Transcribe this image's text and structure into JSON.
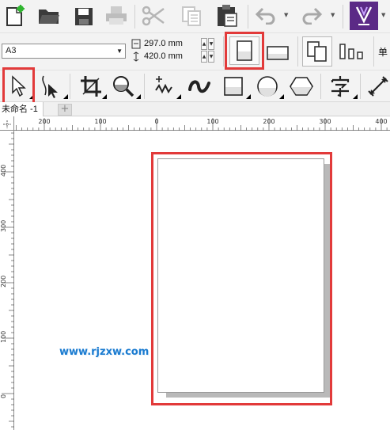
{
  "toolbar_standard": {
    "buttons": [
      {
        "name": "new-document-icon"
      },
      {
        "name": "open-folder-icon"
      },
      {
        "name": "save-icon"
      },
      {
        "name": "print-icon"
      },
      {
        "name": "cut-icon"
      },
      {
        "name": "copy-icon"
      },
      {
        "name": "paste-icon"
      },
      {
        "name": "undo-icon"
      },
      {
        "name": "redo-icon"
      },
      {
        "name": "corel-app-launcher-icon"
      }
    ]
  },
  "property_bar": {
    "page_size": "A3",
    "width": "297.0 mm",
    "height": "420.0 mm",
    "units_label": "单"
  },
  "document": {
    "tab_title": "未命名 -1",
    "add_tab": "+"
  },
  "rulers": {
    "horizontal": [
      "200",
      "100",
      "0",
      "100",
      "200",
      "300",
      "400"
    ],
    "vertical": [
      "400",
      "300",
      "200",
      "100",
      "0"
    ]
  },
  "watermark": "www.rjzxw.com",
  "colors": {
    "highlight": "#e23a3a",
    "toolbar_bg": "#f3f3f3",
    "watermark": "#1a7bd0"
  }
}
